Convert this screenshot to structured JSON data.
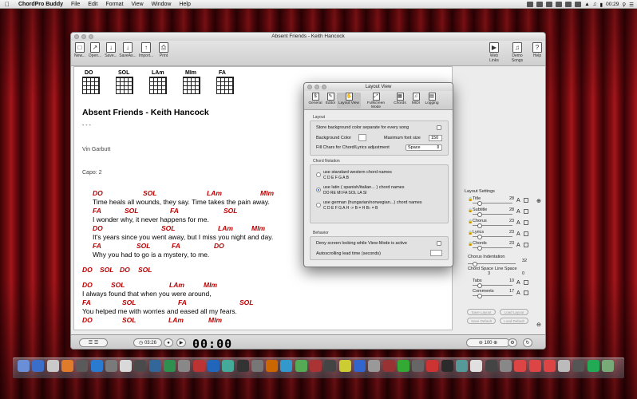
{
  "menubar": {
    "app": "ChordPro Buddy",
    "items": [
      "File",
      "Edit",
      "Format",
      "View",
      "Window",
      "Help"
    ],
    "clock": "00:29"
  },
  "window": {
    "title": "Absent Friends - Keith Hancock",
    "toolbar_left": [
      "New...",
      "Open...",
      "Save...",
      "SaveAs...",
      "Import...",
      "Print"
    ],
    "toolbar_right": [
      "Web Links",
      "Demo Songs",
      "Help"
    ]
  },
  "song": {
    "chords": [
      "DO",
      "SOL",
      "LAm",
      "MIm",
      "FA"
    ],
    "title": "Absent Friends - Keith Hancock",
    "dashes": "- - -",
    "artist": "Vin Garbutt",
    "capo": "Capo:  2",
    "lines": [
      {
        "type": "chord",
        "x": 13,
        "items": [
          [
            "DO",
            0
          ],
          [
            "SOL",
            63
          ],
          [
            "LAm",
            143
          ],
          [
            "MIm",
            210
          ]
        ]
      },
      {
        "type": "lyric",
        "x": 13,
        "text": "Time heals all wounds, they say. Time takes the pain away."
      },
      {
        "type": "chord",
        "x": 13,
        "items": [
          [
            "FA",
            0
          ],
          [
            "SOL",
            40
          ],
          [
            "FA",
            97
          ],
          [
            "SOL",
            164
          ]
        ]
      },
      {
        "type": "lyric",
        "x": 13,
        "text": "I wonder why, it never happens for me."
      },
      {
        "type": "chord",
        "x": 13,
        "items": [
          [
            "DO",
            0
          ],
          [
            "SOL",
            86
          ],
          [
            "LAm",
            157
          ],
          [
            "MIm",
            199
          ]
        ]
      },
      {
        "type": "lyric",
        "x": 13,
        "text": "It's years since you went away, but I miss you night and day."
      },
      {
        "type": "chord",
        "x": 13,
        "items": [
          [
            "FA",
            0
          ],
          [
            "SOL",
            55
          ],
          [
            "FA",
            99
          ],
          [
            "DO",
            152
          ]
        ]
      },
      {
        "type": "lyric",
        "x": 13,
        "text": "Why you had to go is a mystery, to me."
      },
      {
        "type": "gap"
      },
      {
        "type": "chord",
        "x": 0,
        "items": [
          [
            "DO",
            0
          ],
          [
            "SOL",
            22
          ],
          [
            "DO",
            47
          ],
          [
            "SOL",
            70
          ]
        ]
      },
      {
        "type": "gap"
      },
      {
        "type": "chord",
        "x": 0,
        "items": [
          [
            "DO",
            0
          ],
          [
            "SOL",
            36
          ],
          [
            "LAm",
            109
          ],
          [
            "MIm",
            152
          ]
        ]
      },
      {
        "type": "lyric",
        "x": 0,
        "text": "I always found that when you were around,"
      },
      {
        "type": "chord",
        "x": 0,
        "items": [
          [
            "FA",
            0
          ],
          [
            "SOL",
            50
          ],
          [
            "FA",
            120
          ],
          [
            "SOL",
            197
          ]
        ]
      },
      {
        "type": "lyric",
        "x": 0,
        "text": "You helped me with worries and eased all my fears."
      },
      {
        "type": "chord",
        "x": 0,
        "items": [
          [
            "DO",
            0
          ],
          [
            "SOL",
            50
          ],
          [
            "LAm",
            108
          ],
          [
            "MIm",
            158
          ]
        ]
      }
    ]
  },
  "bottom": {
    "time": "03:26",
    "lcd": "00:00",
    "zoom": "100"
  },
  "layout_settings": {
    "header": "Layout Settings",
    "rows": [
      {
        "label": "Title",
        "value": "28"
      },
      {
        "label": "Subtitle",
        "value": "28"
      },
      {
        "label": "Chorus",
        "value": "23"
      },
      {
        "label": "Lyrics",
        "value": "23"
      },
      {
        "label": "Chords",
        "value": "23"
      }
    ],
    "chorus_indent_label": "Chorus Indentation",
    "chorus_indent": "32",
    "chord_space_label": "Chord Space",
    "chord_space": "3",
    "line_space_label": "Line Space",
    "line_space": "0",
    "tabs_label": "Tabs",
    "tabs": "10",
    "comments_label": "Comments",
    "comments": "17",
    "buttons": [
      "Save Layout",
      "Load Layout",
      "Save Default",
      "Load Default"
    ]
  },
  "dialog": {
    "title": "Layout View",
    "tabs": [
      "General",
      "Editor",
      "Layout View",
      "Fullscreen Mode",
      "Chords",
      "MIDI",
      "Logging"
    ],
    "layout_group": "Layout",
    "store_bg": "Store background color separate for every song",
    "bg_color": "Background Color",
    "max_font": "Maximum font size",
    "max_font_value": "150",
    "fill_chars": "Fill Chars for Chord/Lyrics adjustment",
    "fill_value": "Space",
    "notation_group": "Chord Notation",
    "opt1": "use standard western chord names",
    "opt1_sub": "C  D  E  F  G  A  B",
    "opt2": "use latin ( spanish/italian... ) chord names",
    "opt2_sub": "DO  RE  MI  FA  SOL  LA  SI",
    "opt3": "use german (hungarian/norwegian...) chord names",
    "opt3_sub": "C  D  E  F  G  A  H    ->    B = H    B♭ = B",
    "behavior_group": "Behavior",
    "deny_lock": "Deny screen locking while View-Mode is active",
    "autoscroll": "Autoscrolling lead time (seconds)"
  },
  "colors": {
    "chord": "#b00000",
    "accent": "#1b5fd3"
  }
}
